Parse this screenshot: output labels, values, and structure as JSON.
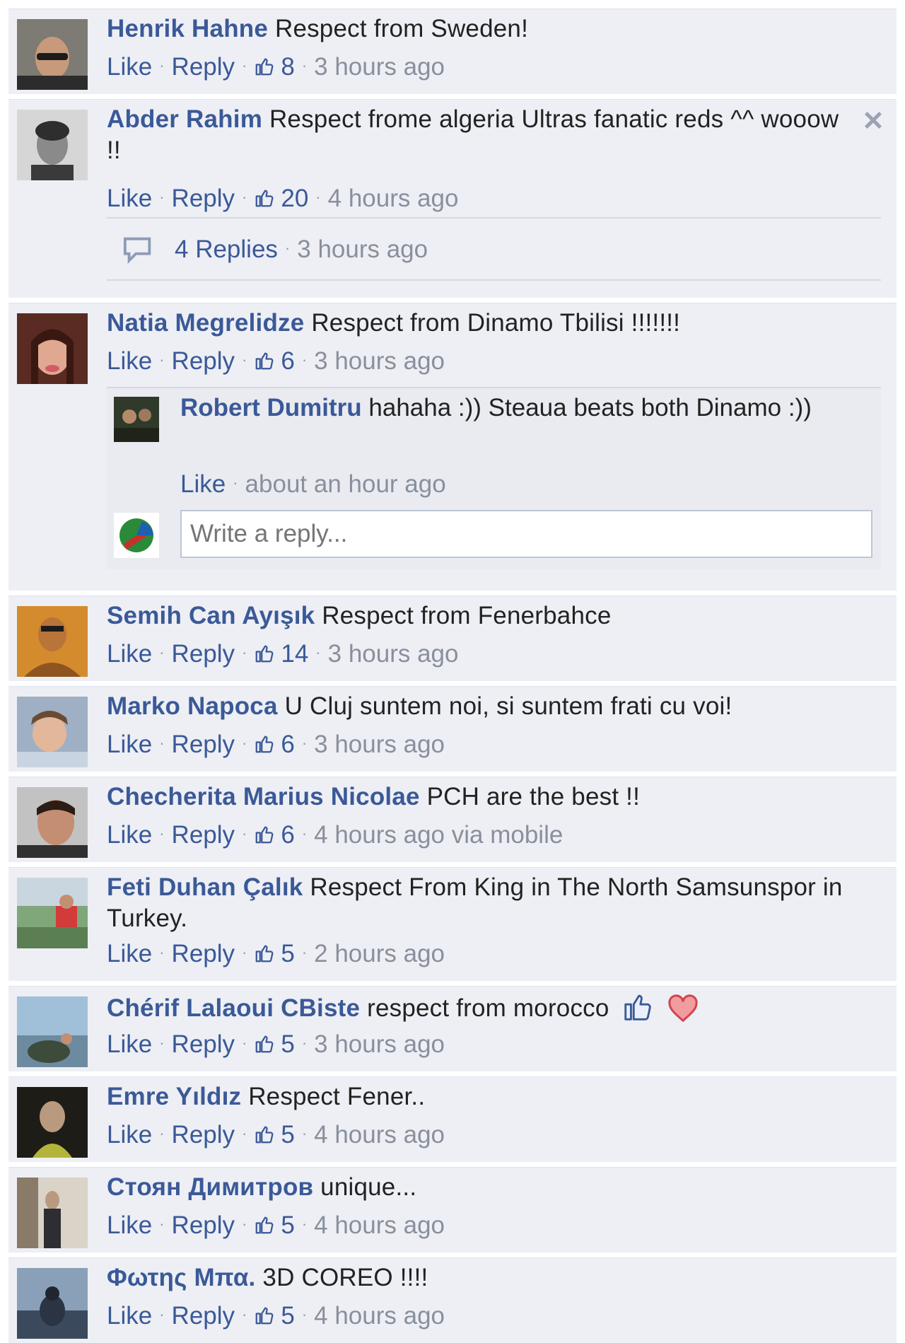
{
  "meta_labels": {
    "like": "Like",
    "reply": "Reply",
    "separator": "·"
  },
  "comments": [
    {
      "name": "Henrik Hahne",
      "text": "Respect from Sweden!",
      "likes": "8",
      "time": "3 hours ago"
    },
    {
      "name": "Abder Rahim",
      "text": "Respect frome algeria Ultras fanatic reds ^^ wooow !!",
      "likes": "20",
      "time": "4 hours ago",
      "replies_summary": {
        "count_text": "4 Replies",
        "time": "3 hours ago"
      }
    },
    {
      "name": "Natia Megrelidze",
      "text": "Respect from Dinamo Tbilisi !!!!!!!",
      "likes": "6",
      "time": "3 hours ago",
      "reply": {
        "name": "Robert Dumitru",
        "text": "hahaha :)) Steaua beats both Dinamo :))",
        "time": "about an hour ago"
      },
      "reply_input_placeholder": "Write a reply..."
    },
    {
      "name": "Semih Can Ayışık",
      "text": "Respect from Fenerbahce",
      "likes": "14",
      "time": "3 hours ago"
    },
    {
      "name": "Marko Napoca",
      "text": "U Cluj suntem noi, si suntem frati cu voi!",
      "likes": "6",
      "time": "3 hours ago"
    },
    {
      "name": "Checherita Marius Nicolae",
      "text": "PCH are the best !!",
      "likes": "6",
      "time": "4 hours ago via mobile"
    },
    {
      "name": "Feti Duhan Çalık",
      "text": "Respect From King in The North Samsunspor in Turkey.",
      "likes": "5",
      "time": "2 hours ago"
    },
    {
      "name": "Chérif Lalaoui CBiste",
      "text": "respect from morocco",
      "likes": "5",
      "time": "3 hours ago",
      "emojis": [
        "thumbs-up-icon",
        "heart-icon"
      ]
    },
    {
      "name": "Emre Yıldız",
      "text": "Respect Fener..",
      "likes": "5",
      "time": "4 hours ago"
    },
    {
      "name": "Стоян Димитров",
      "text": "unique...",
      "likes": "5",
      "time": "4 hours ago"
    },
    {
      "name": "Φωτης Μπα.",
      "text": "3D COREO !!!!",
      "likes": "5",
      "time": "4 hours ago"
    }
  ],
  "colors": {
    "link": "#3b5998",
    "meta": "#898f9c",
    "background": "#edeff4",
    "heart": "#e0505a"
  }
}
